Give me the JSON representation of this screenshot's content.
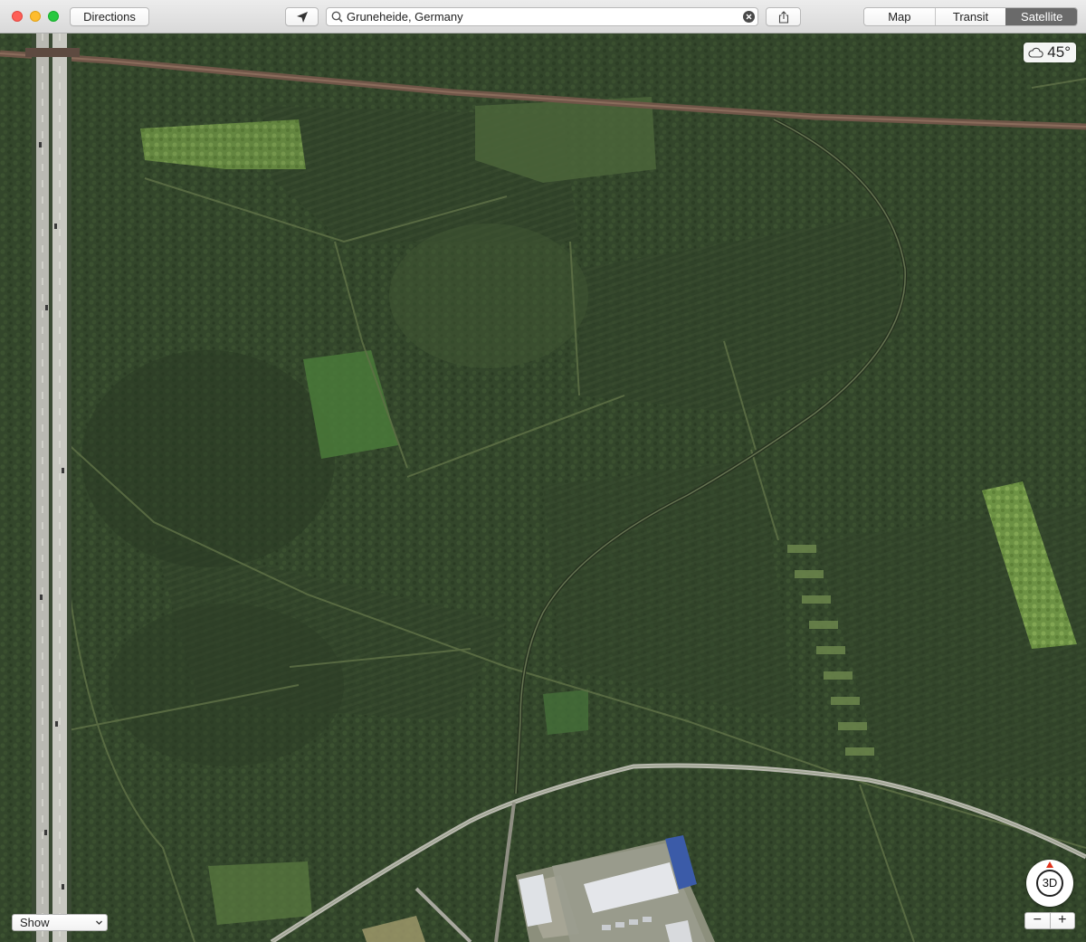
{
  "toolbar": {
    "directions_label": "Directions",
    "locate_icon": "location-arrow-icon",
    "search": {
      "value": "Gruneheide, Germany",
      "icon": "magnifier-icon",
      "clear_icon": "clear-x-icon"
    },
    "share_icon": "share-icon",
    "view_modes": [
      {
        "label": "Map",
        "active": false
      },
      {
        "label": "Transit",
        "active": false
      },
      {
        "label": "Satellite",
        "active": true
      }
    ]
  },
  "map": {
    "weather": {
      "icon": "cloud-icon",
      "temperature": "45°"
    },
    "show_menu_label": "Show",
    "compass_label": "3D",
    "zoom_out_label": "−",
    "zoom_in_label": "+"
  },
  "colors": {
    "forest": "#34472c",
    "forest_light": "#4b6238",
    "clearing": "#7aa24b",
    "road": "#c9c9c2",
    "railway": "#7a5a4a",
    "segment_active": "#6a6a6a"
  }
}
